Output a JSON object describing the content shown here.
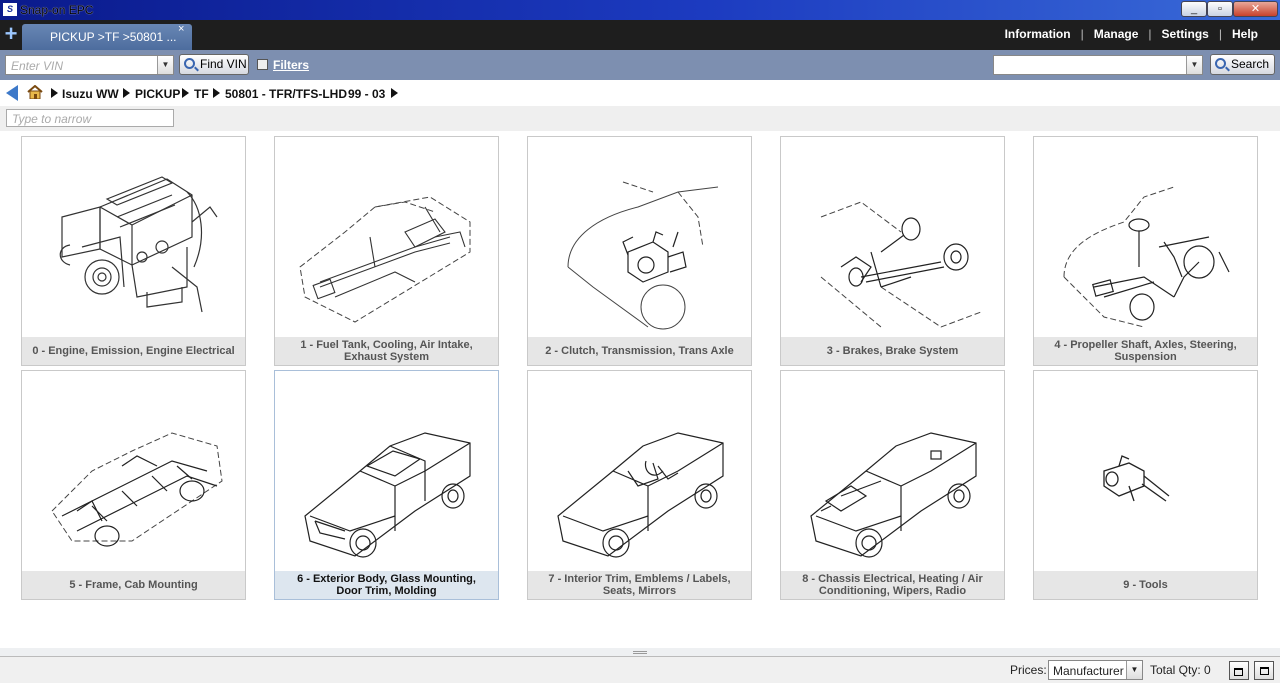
{
  "window": {
    "title": "Snap-on EPC",
    "app_icon": "S"
  },
  "tabs": [
    {
      "label": "PICKUP >TF >50801 ...",
      "close": "×"
    }
  ],
  "menu": [
    "Information",
    "Manage",
    "Settings",
    "Help"
  ],
  "toolbar": {
    "vin_placeholder": "Enter VIN",
    "find_vin_label": "Find VIN",
    "filters_label": "Filters",
    "search_label": "Search"
  },
  "breadcrumb": [
    "Isuzu WW",
    "PICKUP",
    "TF",
    "50801 - TFR/TFS-LHD",
    "99 - 03"
  ],
  "narrow_placeholder": "Type to narrow",
  "categories": [
    {
      "label": "0 - Engine, Emission, Engine Electrical",
      "icon": "engine-illustration"
    },
    {
      "label": "1 - Fuel Tank, Cooling, Air Intake, Exhaust System",
      "icon": "fuel-system-illustration"
    },
    {
      "label": "2 - Clutch, Transmission, Trans Axle",
      "icon": "clutch-illustration"
    },
    {
      "label": "3 - Brakes, Brake System",
      "icon": "brakes-illustration"
    },
    {
      "label": "4 - Propeller Shaft, Axles, Steering, Suspension",
      "icon": "steering-illustration"
    },
    {
      "label": "5 - Frame, Cab Mounting",
      "icon": "frame-illustration"
    },
    {
      "label": "6 - Exterior Body, Glass Mounting, Door Trim, Molding",
      "icon": "exterior-body-illustration"
    },
    {
      "label": "7 - Interior Trim, Emblems / Labels, Seats, Mirrors",
      "icon": "interior-trim-illustration"
    },
    {
      "label": "8 - Chassis Electrical, Heating / Air Conditioning, Wipers, Radio",
      "icon": "chassis-electrical-illustration"
    },
    {
      "label": "9 - Tools",
      "icon": "tools-illustration"
    }
  ],
  "status": {
    "prices_label": "Prices:",
    "prices_value": "Manufacturer",
    "total_qty": "Total Qty: 0"
  }
}
